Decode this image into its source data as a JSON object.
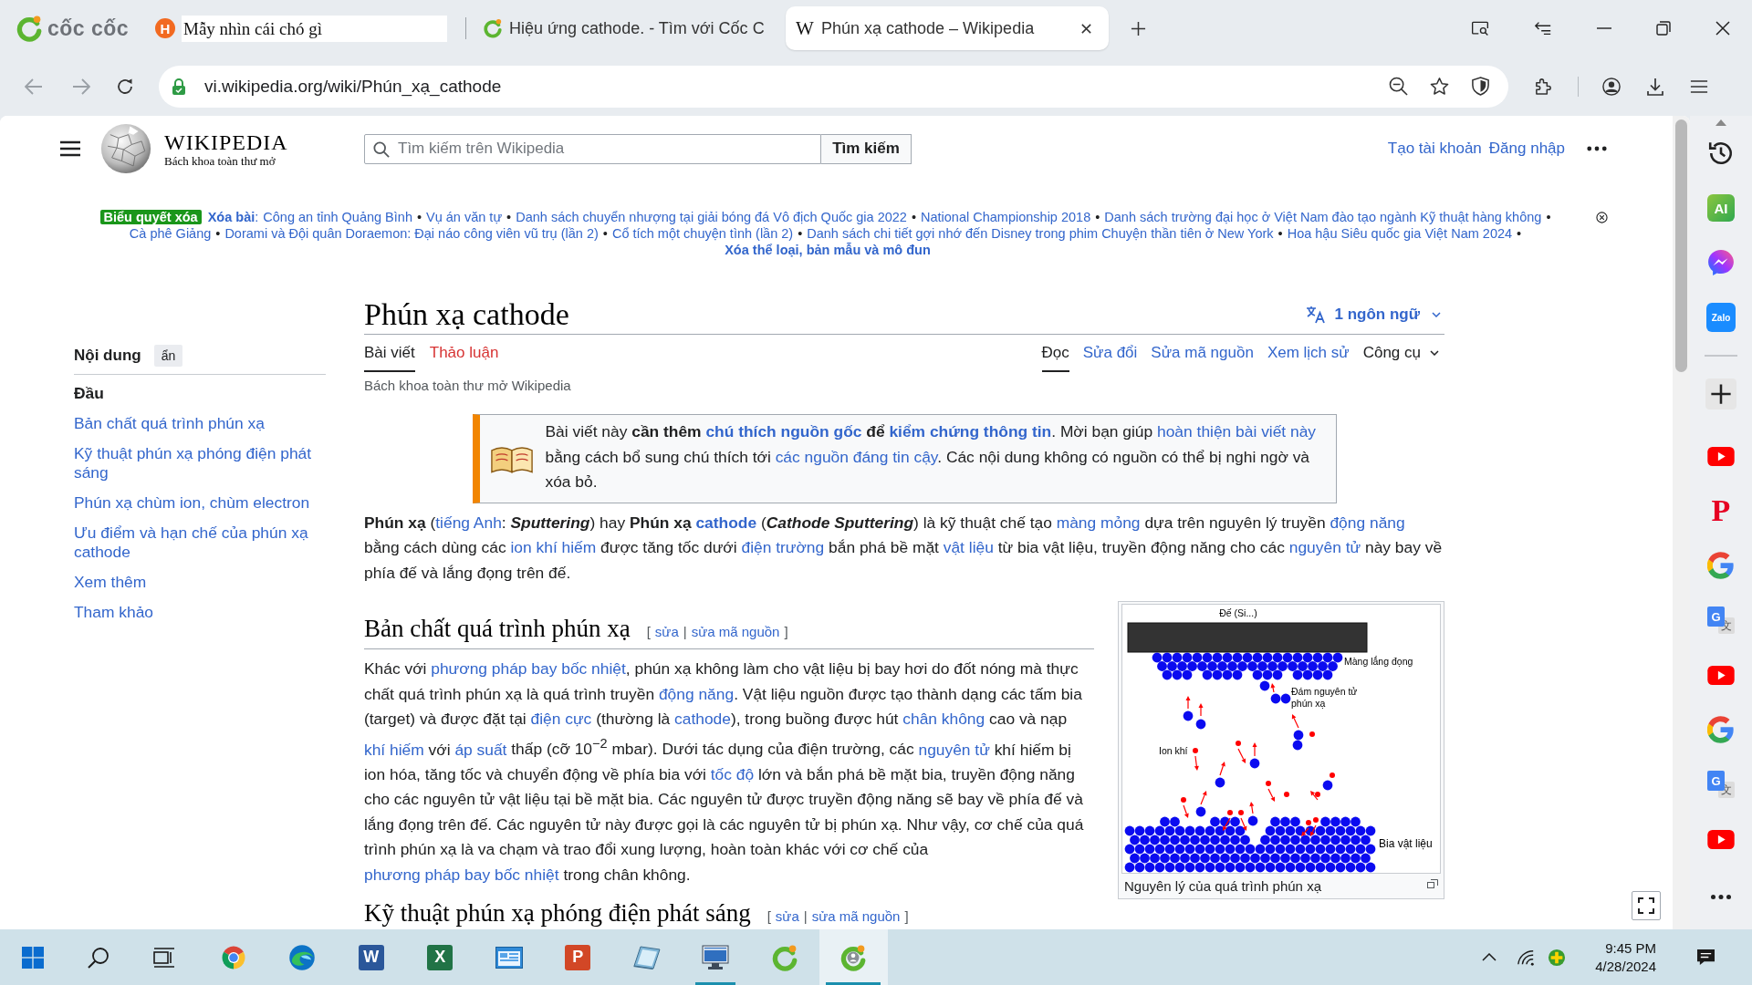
{
  "browser": {
    "logo_text": "cốc cốc",
    "tabs": [
      {
        "title": "Mẫy nhìn cái chó gì",
        "selected": false,
        "renaming": true,
        "kind": "letter",
        "glyph": "H"
      },
      {
        "title": "Hiệu ứng cathode. - Tìm với Cốc C",
        "selected": false,
        "renaming": false,
        "kind": "swirl"
      },
      {
        "title": "Phún xạ cathode – Wikipedia",
        "selected": true,
        "renaming": false,
        "kind": "serif-letter",
        "glyph": "W"
      }
    ],
    "address": "vi.wikipedia.org/wiki/Phún_xạ_cathode"
  },
  "wiki": {
    "wordmark": "WIKIPEDIA",
    "tagline": "Bách khoa toàn thư mở",
    "search": {
      "placeholder": "Tìm kiếm trên Wikipedia",
      "button": "Tìm kiếm"
    },
    "user_links": [
      "Tạo tài khoản",
      "Đăng nhập"
    ],
    "banner": {
      "badge": "Biểu quyết xóa",
      "lead": "Xóa bài",
      "lead_sep": ":",
      "separator": "•",
      "items": [
        "Công an tỉnh Quảng Bình",
        "Vụ án văn tự",
        "Danh sách chuyển nhượng tại giải bóng đá Vô địch Quốc gia 2022",
        "National Championship 2018",
        "Danh sách trường đại học ở Việt Nam đào tạo ngành Kỹ thuật hàng không",
        "Cà phê Giảng",
        "Dorami và Đội quân Doraemon: Đại náo công viên vũ trụ (lần 2)",
        "Cổ tích một chuyện tình (lần 2)",
        "Danh sách chi tiết gợi nhớ đến Disney trong phim Chuyện thần tiên ở New York",
        "Hoa hậu Siêu quốc gia Việt Nam 2024"
      ],
      "tail": "Xóa thể loại, bản mẫu và mô đun"
    },
    "toc": {
      "title": "Nội dung",
      "hide": "ẩn",
      "items": [
        {
          "label": "Đầu",
          "selected": true
        },
        {
          "label": "Bản chất quá trình phún xạ",
          "selected": false
        },
        {
          "label": "Kỹ thuật phún xạ phóng điện phát sáng",
          "selected": false
        },
        {
          "label": "Phún xạ chùm ion, chùm electron",
          "selected": false
        },
        {
          "label": "Ưu điểm và hạn chế của phún xạ cathode",
          "selected": false
        },
        {
          "label": "Xem thêm",
          "selected": false
        },
        {
          "label": "Tham khảo",
          "selected": false
        }
      ]
    },
    "article": {
      "title": "Phún xạ cathode",
      "languages": "1 ngôn ngữ",
      "tabs": [
        {
          "label": "Bài viết",
          "selected": true,
          "missing": false
        },
        {
          "label": "Thảo luận",
          "selected": false,
          "missing": true
        }
      ],
      "views": [
        {
          "label": "Đọc",
          "selected": true,
          "kind": "view"
        },
        {
          "label": "Sửa đổi",
          "selected": false,
          "kind": "view"
        },
        {
          "label": "Sửa mã nguồn",
          "selected": false,
          "kind": "view"
        },
        {
          "label": "Xem lịch sử",
          "selected": false,
          "kind": "view"
        },
        {
          "label": "Công cụ",
          "selected": false,
          "kind": "menu"
        }
      ],
      "tagline": "Bách khoa toàn thư mở Wikipedia",
      "notice": [
        {
          "kind": "text",
          "text": "Bài viết này **cần thêm** "
        },
        {
          "kind": "strong-link",
          "text": "chú thích nguồn gốc"
        },
        {
          "kind": "text",
          "text": " **để** "
        },
        {
          "kind": "strong-link",
          "text": "kiểm chứng thông tin"
        },
        {
          "kind": "text",
          "text": ". Mời bạn giúp "
        },
        {
          "kind": "link",
          "text": "hoàn thiện bài viết này"
        },
        {
          "kind": "text",
          "text": " bằng cách bổ sung chú thích tới "
        },
        {
          "kind": "link",
          "text": "các nguồn đáng tin cậy"
        },
        {
          "kind": "text",
          "text": ". Các nội dung không có nguồn có thể bị nghi ngờ và xóa bỏ."
        }
      ],
      "intro": [
        {
          "kind": "text",
          "text": "**Phún xạ** ("
        },
        {
          "kind": "link",
          "text": "tiếng Anh"
        },
        {
          "kind": "text",
          "text": ": "
        },
        {
          "kind": "strong-em",
          "text": "Sputtering"
        },
        {
          "kind": "text",
          "text": ") hay **Phún xạ** "
        },
        {
          "kind": "strong-link",
          "text": "cathode"
        },
        {
          "kind": "text",
          "text": " ("
        },
        {
          "kind": "strong-em",
          "text": "Cathode Sputtering"
        },
        {
          "kind": "text",
          "text": ") là kỹ thuật chế tạo "
        },
        {
          "kind": "link",
          "text": "màng mỏng"
        },
        {
          "kind": "text",
          "text": " dựa trên nguyên lý truyền "
        },
        {
          "kind": "link",
          "text": "động năng"
        },
        {
          "kind": "text",
          "text": " bằng cách dùng các "
        },
        {
          "kind": "link",
          "text": "ion khí hiếm"
        },
        {
          "kind": "text",
          "text": " được tăng tốc dưới "
        },
        {
          "kind": "link",
          "text": "điện trường"
        },
        {
          "kind": "text",
          "text": " bắn phá bề mặt "
        },
        {
          "kind": "link",
          "text": "vật liệu"
        },
        {
          "kind": "text",
          "text": " từ bia vật liệu, truyền động năng cho các "
        },
        {
          "kind": "link",
          "text": "nguyên tử"
        },
        {
          "kind": "text",
          "text": " này bay về phía đế và lắng đọng trên đế."
        }
      ],
      "figure": {
        "labels": {
          "substrate": "Đế (Si...)",
          "film": "Màng lắng đọng",
          "cluster": [
            "Đám nguyên tử",
            "phún xạ"
          ],
          "ion": "Ion khí",
          "target": "Bia vật liệu"
        },
        "caption": "Nguyên lý của quá trình phún xạ"
      },
      "sections": [
        {
          "title": "Bản chất quá trình phún xạ",
          "edit": {
            "open": "[",
            "links": [
              "sửa",
              "sửa mã nguồn"
            ],
            "separator": "|",
            "close": "]"
          },
          "paragraph": [
            {
              "kind": "text",
              "text": "Khác với "
            },
            {
              "kind": "link",
              "text": "phương pháp bay bốc nhiệt"
            },
            {
              "kind": "text",
              "text": ", phún xạ không làm cho vật liệu bị bay hơi do đốt nóng mà thực chất quá trình phún xạ là quá trình truyền "
            },
            {
              "kind": "link",
              "text": "động năng"
            },
            {
              "kind": "text",
              "text": ". Vật liệu nguồn được tạo thành dạng các tấm bia (target) và được đặt tại "
            },
            {
              "kind": "link",
              "text": "điện cực"
            },
            {
              "kind": "text",
              "text": " (thường là "
            },
            {
              "kind": "link",
              "text": "cathode"
            },
            {
              "kind": "text",
              "text": "), trong buồng được hút "
            },
            {
              "kind": "link",
              "text": "chân không"
            },
            {
              "kind": "text",
              "text": " cao và nạp "
            },
            {
              "kind": "link",
              "text": "khí hiếm"
            },
            {
              "kind": "text",
              "text": " với "
            },
            {
              "kind": "link",
              "text": "áp suất"
            },
            {
              "kind": "text",
              "text": " thấp (cỡ 10$^{−2}$ mbar). Dưới tác dụng của điện trường, các "
            },
            {
              "kind": "link",
              "text": "nguyên tử"
            },
            {
              "kind": "text",
              "text": " khí hiếm bị ion hóa, tăng tốc và chuyển động về phía bia với "
            },
            {
              "kind": "link",
              "text": "tốc độ"
            },
            {
              "kind": "text",
              "text": " lớn và bắn phá bề mặt bia, truyền động năng cho các nguyên tử vật liệu tại bề mặt bia. Các nguyên tử được truyền động năng sẽ bay về phía đế và lắng đọng trên đế. Các nguyên tử này được gọi là các nguyên tử bị phún xạ. Như vậy, cơ chế của quá trình phún xạ là va chạm và trao đổi xung lượng, hoàn toàn khác với cơ chế của "
            },
            {
              "kind": "link",
              "text": "phương pháp bay bốc nhiệt"
            },
            {
              "kind": "text",
              "text": " trong chân không."
            }
          ]
        },
        {
          "title": "Kỹ thuật phún xạ phóng điện phát sáng",
          "edit": {
            "open": "[",
            "links": [
              "sửa",
              "sửa mã nguồn"
            ],
            "separator": "|",
            "close": "]"
          }
        }
      ]
    }
  },
  "browser_sidebar": [
    {
      "kind": "history"
    },
    {
      "kind": "ai",
      "glyph": "AI"
    },
    {
      "kind": "messenger"
    },
    {
      "kind": "zalo",
      "glyph": "Zalo"
    },
    {
      "kind": "divider"
    },
    {
      "kind": "add"
    },
    {
      "kind": "youtube"
    },
    {
      "kind": "pinterest",
      "glyph": "P"
    },
    {
      "kind": "google"
    },
    {
      "kind": "translate",
      "glyph": "G",
      "glyph2": "文"
    },
    {
      "kind": "youtube"
    },
    {
      "kind": "google"
    },
    {
      "kind": "translate",
      "glyph": "G",
      "glyph2": "文"
    },
    {
      "kind": "youtube"
    },
    {
      "kind": "more"
    }
  ],
  "taskbar": {
    "apps": [
      {
        "kind": "start",
        "running": false,
        "active": false
      },
      {
        "kind": "search",
        "running": false,
        "active": false
      },
      {
        "kind": "task-view",
        "running": false,
        "active": false
      },
      {
        "kind": "chrome",
        "running": false,
        "active": false
      },
      {
        "kind": "edge",
        "running": false,
        "active": false
      },
      {
        "kind": "word",
        "glyph": "W",
        "running": false,
        "active": false
      },
      {
        "kind": "excel",
        "glyph": "X",
        "running": false,
        "active": false
      },
      {
        "kind": "window-app",
        "running": false,
        "active": false
      },
      {
        "kind": "powerpoint",
        "glyph": "P",
        "running": false,
        "active": false
      },
      {
        "kind": "notebook",
        "running": false,
        "active": false
      },
      {
        "kind": "monitor",
        "running": true,
        "active": false
      },
      {
        "kind": "swirl",
        "running": false,
        "active": false
      },
      {
        "kind": "swirl-user",
        "running": true,
        "active": true
      }
    ],
    "time": "9:45 PM",
    "date": "4/28/2024"
  }
}
